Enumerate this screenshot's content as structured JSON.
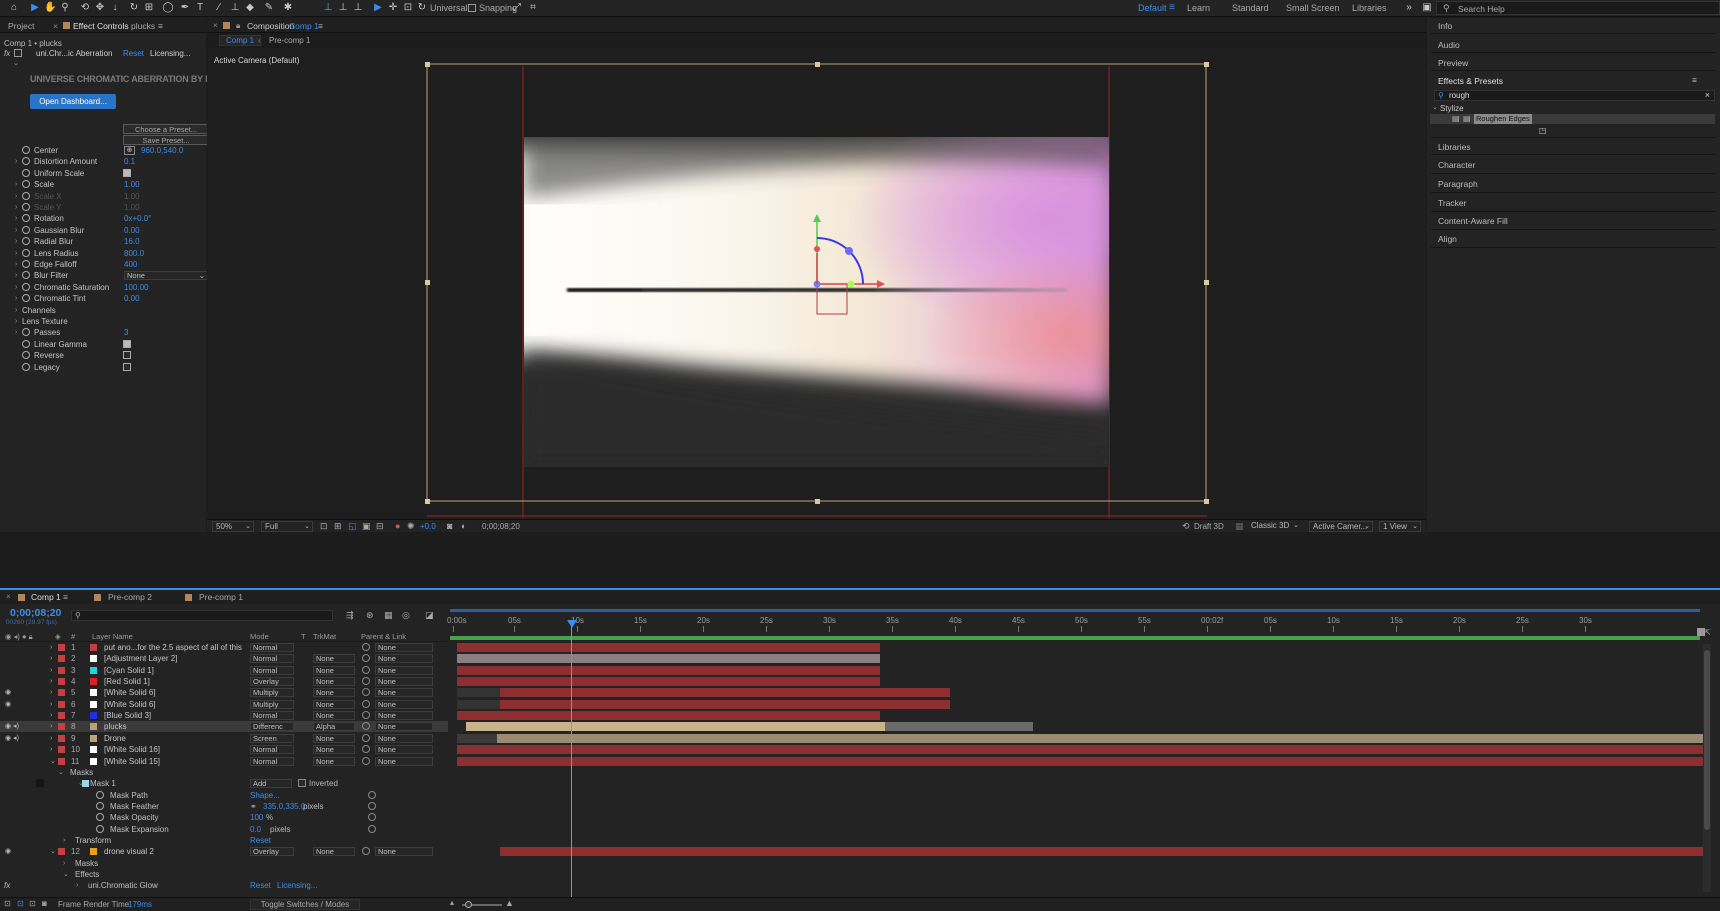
{
  "toolbar": {
    "universal_label": "Universal",
    "snapping_label": "Snapping",
    "workspaces": [
      "Default",
      "Learn",
      "Standard",
      "Small Screen",
      "Libraries"
    ],
    "search_placeholder": "Search Help"
  },
  "left_panel": {
    "tab_project": "Project",
    "tab_effect_controls": "Effect Controls",
    "tab_effect_layer": "plucks",
    "breadcrumb": "Comp 1 • plucks",
    "effect_name": "uni.Chr...ic Aberration",
    "reset_label": "Reset",
    "licensing_label": "Licensing...",
    "brand_title": "UNIVERSE CHROMATIC ABERRATION BY MAXON",
    "open_dashboard_label": "Open Dashboard...",
    "choose_preset_label": "Choose a Preset...",
    "save_preset_label": "Save Preset...",
    "params": [
      {
        "name": "Center",
        "value": "960.0,540.0"
      },
      {
        "name": "Distortion Amount",
        "value": "0.1"
      },
      {
        "name": "Uniform Scale",
        "value": ""
      },
      {
        "name": "Scale",
        "value": "1.00"
      },
      {
        "name": "Scale X",
        "value": "1.00"
      },
      {
        "name": "Scale Y",
        "value": "1.00"
      },
      {
        "name": "Rotation",
        "value": "0x+0.0°"
      },
      {
        "name": "Gaussian Blur",
        "value": "0.00"
      },
      {
        "name": "Radial Blur",
        "value": "16.0"
      },
      {
        "name": "Lens Radius",
        "value": "800.0"
      },
      {
        "name": "Edge Falloff",
        "value": "400"
      },
      {
        "name": "Blur Filter",
        "value": "None"
      },
      {
        "name": "Chromatic Saturation",
        "value": "100.00"
      },
      {
        "name": "Chromatic Tint",
        "value": "0.00"
      },
      {
        "name": "Channels",
        "value": ""
      },
      {
        "name": "Lens Texture",
        "value": ""
      },
      {
        "name": "Passes",
        "value": "3"
      },
      {
        "name": "Linear Gamma",
        "value": ""
      },
      {
        "name": "Reverse",
        "value": ""
      },
      {
        "name": "Legacy",
        "value": ""
      }
    ]
  },
  "viewer": {
    "tab_prefix": "Composition",
    "tab_name": "Comp 1",
    "crumb_1": "Comp 1",
    "crumb_2": "Pre-comp 1",
    "camera_label": "Active Camera (Default)",
    "zoom": "50%",
    "resolution": "Full",
    "exposure": "+0.0",
    "timecode": "0;00;08;20",
    "renderer": "Draft 3D",
    "classic": "Classic 3D",
    "camera_select": "Active Camer...",
    "views": "1 View"
  },
  "right_panel": {
    "info": "Info",
    "audio": "Audio",
    "preview": "Preview",
    "effects_presets": "Effects & Presets",
    "search_value": "rough",
    "category": "Stylize",
    "result": "Roughen Edges",
    "libraries": "Libraries",
    "character": "Character",
    "paragraph": "Paragraph",
    "tracker": "Tracker",
    "content_aware": "Content-Aware Fill",
    "align": "Align"
  },
  "timeline": {
    "tabs": [
      "Comp 1",
      "Pre-comp 2",
      "Pre-comp 1"
    ],
    "timecode": "0;00;08;20",
    "fps": "00260 (29.97 fps)",
    "headers": {
      "layer_name": "Layer Name",
      "mode": "Mode",
      "t": "T",
      "trkmat": "TrkMat",
      "parent": "Parent & Link",
      "num": "#"
    },
    "ticks": [
      "0:00s",
      "05s",
      "10s",
      "15s",
      "20s",
      "25s",
      "30s",
      "35s",
      "40s",
      "45s",
      "50s",
      "55s",
      "00:02f",
      "05s",
      "10s",
      "15s",
      "20s",
      "25s",
      "30s"
    ],
    "layers": [
      {
        "num": "1",
        "name": "put ano...for the 2.5 aspect of all of this",
        "mode": "Normal",
        "trkmat": "",
        "parent": "None",
        "color": "#c44040"
      },
      {
        "num": "2",
        "name": "[Adjustment Layer 2]",
        "mode": "Normal",
        "trkmat": "None",
        "parent": "None",
        "color": "#ffffff"
      },
      {
        "num": "3",
        "name": "[Cyan Solid 1]",
        "mode": "Normal",
        "trkmat": "None",
        "parent": "None",
        "color": "#22d4e0"
      },
      {
        "num": "4",
        "name": "[Red Solid 1]",
        "mode": "Overlay",
        "trkmat": "None",
        "parent": "None",
        "color": "#e02020"
      },
      {
        "num": "5",
        "name": "[White Solid 6]",
        "mode": "Multiply",
        "trkmat": "None",
        "parent": "None",
        "color": "#ffffff"
      },
      {
        "num": "6",
        "name": "[White Solid 6]",
        "mode": "Multiply",
        "trkmat": "None",
        "parent": "None",
        "color": "#ffffff"
      },
      {
        "num": "7",
        "name": "[Blue Solid 3]",
        "mode": "Normal",
        "trkmat": "None",
        "parent": "None",
        "color": "#2030e0"
      },
      {
        "num": "8",
        "name": "plucks",
        "mode": "Differenc",
        "trkmat": "Alpha",
        "parent": "None",
        "color": "#b8a27a"
      },
      {
        "num": "9",
        "name": "Drone",
        "mode": "Screen",
        "trkmat": "None",
        "parent": "None",
        "color": "#b8a27a"
      },
      {
        "num": "10",
        "name": "[White Solid 16]",
        "mode": "Normal",
        "trkmat": "None",
        "parent": "None",
        "color": "#ffffff"
      },
      {
        "num": "11",
        "name": "[White Solid 15]",
        "mode": "Normal",
        "trkmat": "None",
        "parent": "None",
        "color": "#ffffff"
      }
    ],
    "masks_label": "Masks",
    "mask1_label": "Mask 1",
    "mask_mode": "Add",
    "inverted_label": "Inverted",
    "mask_path_label": "Mask Path",
    "mask_path_value": "Shape...",
    "mask_feather_label": "Mask Feather",
    "mask_feather_value": "335.0,335.0",
    "mask_feather_unit": "pixels",
    "mask_opacity_label": "Mask Opacity",
    "mask_opacity_value": "100",
    "mask_opacity_unit": "%",
    "mask_expansion_label": "Mask Expansion",
    "mask_expansion_value": "0.0",
    "mask_expansion_unit": "pixels",
    "transform_label": "Transform",
    "transform_reset": "Reset",
    "layer12": {
      "num": "12",
      "name": "drone visual 2",
      "mode": "Overlay",
      "trkmat": "None",
      "parent": "None",
      "color": "#e6a020"
    },
    "masks2_label": "Masks",
    "effects_label": "Effects",
    "glow_label": "uni.Chromatic Glow",
    "glow_reset": "Reset",
    "glow_licensing": "Licensing...",
    "frame_render_label": "Frame Render Time:",
    "frame_render_value": "179ms",
    "toggle_label": "Toggle Switches / Modes"
  }
}
